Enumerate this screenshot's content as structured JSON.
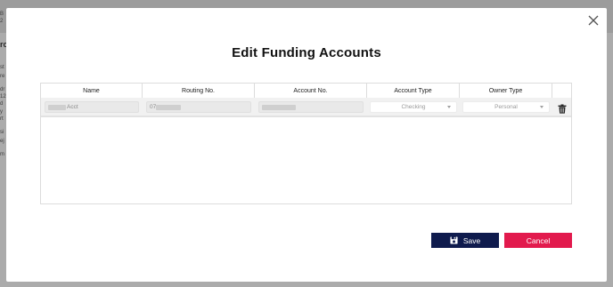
{
  "modal": {
    "title": "Edit Funding Accounts",
    "close_icon": "close-icon"
  },
  "table": {
    "headers": [
      "Name",
      "Routing No.",
      "Account No.",
      "Account Type",
      "Owner Type"
    ],
    "rows": [
      {
        "name": "Acct",
        "routing": "07",
        "account": "",
        "account_type": "Checking",
        "owner_type": "Personal"
      }
    ],
    "delete_icon": "trash-icon"
  },
  "actions": {
    "save_label": "Save",
    "cancel_label": "Cancel"
  },
  "colors": {
    "save": "#0f1b4d",
    "cancel": "#e21a4d",
    "overlay": "#8d8d8d"
  }
}
